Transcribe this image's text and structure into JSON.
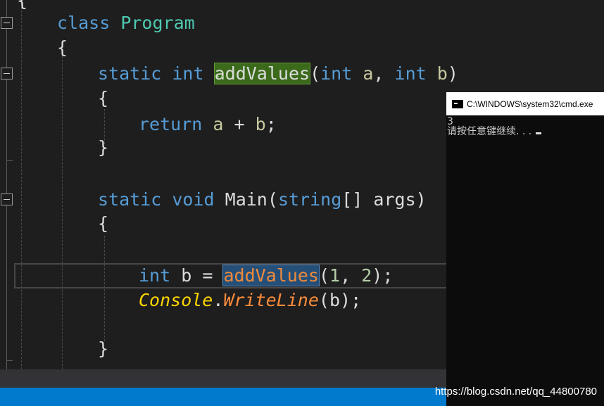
{
  "editor": {
    "lines": {
      "opening_brace": "{",
      "class_kw": "class",
      "class_name": "Program",
      "class_open": "{",
      "static1": "static",
      "int1": "int",
      "method_def": "addValues",
      "paren_open1": "(",
      "int_a": "int",
      "param_a": "a",
      "comma1": ",",
      "int_b": "int",
      "param_b": "b",
      "paren_close1": ")",
      "method_open": "{",
      "return_kw": "return",
      "ret_a": "a",
      "plus": "+",
      "ret_b": "b",
      "semi1": ";",
      "method_close": "}",
      "static2": "static",
      "void_kw": "void",
      "main_name": "Main",
      "paren_open2": "(",
      "string_kw": "string",
      "brackets": "[]",
      "args": "args",
      "paren_close2": ")",
      "main_open": "{",
      "int_kw3": "int",
      "var_b": "b",
      "equals": "=",
      "call_fn": "addValues",
      "paren_open3": "(",
      "num1": "1",
      "comma3": ",",
      "num2": "2",
      "paren_close3": ")",
      "semi3": ";",
      "console_cls": "Console",
      "dot": ".",
      "writeline": "WriteLine",
      "paren_open4": "(",
      "arg_b": "b",
      "paren_close4": ")",
      "semi4": ";",
      "main_close": "}"
    }
  },
  "console": {
    "title": "C:\\WINDOWS\\system32\\cmd.exe",
    "output_line1": "3",
    "output_line2": "请按任意键继续. . ."
  },
  "watermark": "https://blog.csdn.net/qq_44800780"
}
